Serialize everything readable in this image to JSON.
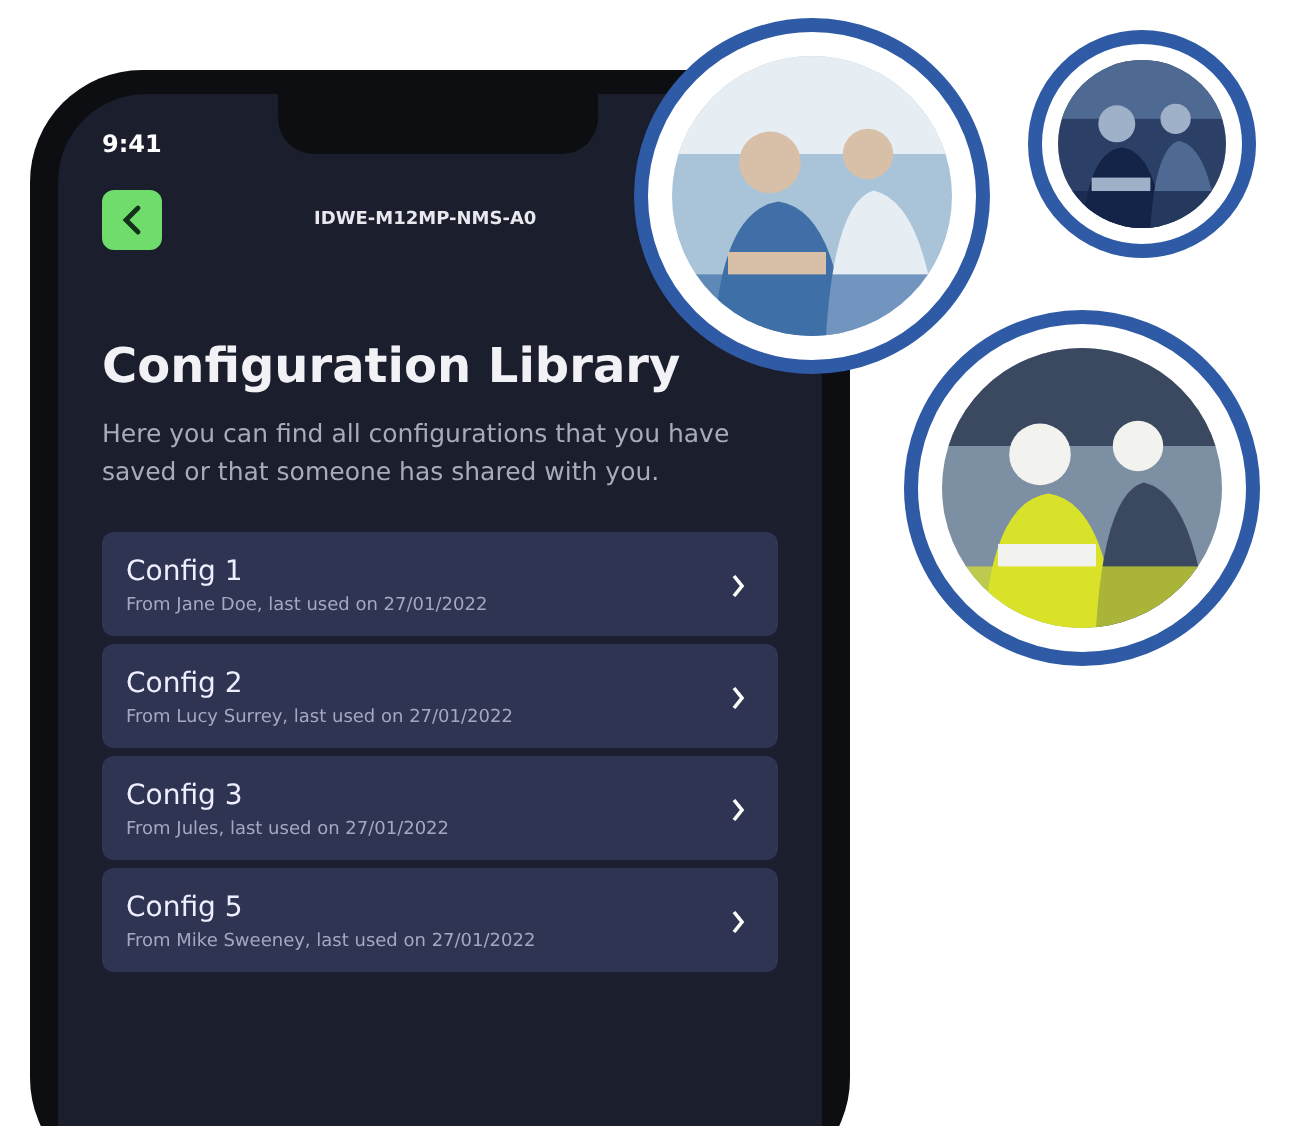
{
  "status_bar": {
    "time": "9:41"
  },
  "header": {
    "title": "IDWE-M12MP-NMS-A0"
  },
  "heading": "Configuration Library",
  "description": "Here you can find all configurations that you have saved or that someone has shared with you.",
  "configs": [
    {
      "title": "Config 1",
      "subtitle": "From Jane Doe, last used on 27/01/2022"
    },
    {
      "title": "Config 2",
      "subtitle": "From Lucy Surrey, last used on 27/01/2022"
    },
    {
      "title": "Config 3",
      "subtitle": "From Jules, last used on 27/01/2022"
    },
    {
      "title": "Config 5",
      "subtitle": "From Mike Sweeney, last used on 27/01/2022"
    }
  ]
}
